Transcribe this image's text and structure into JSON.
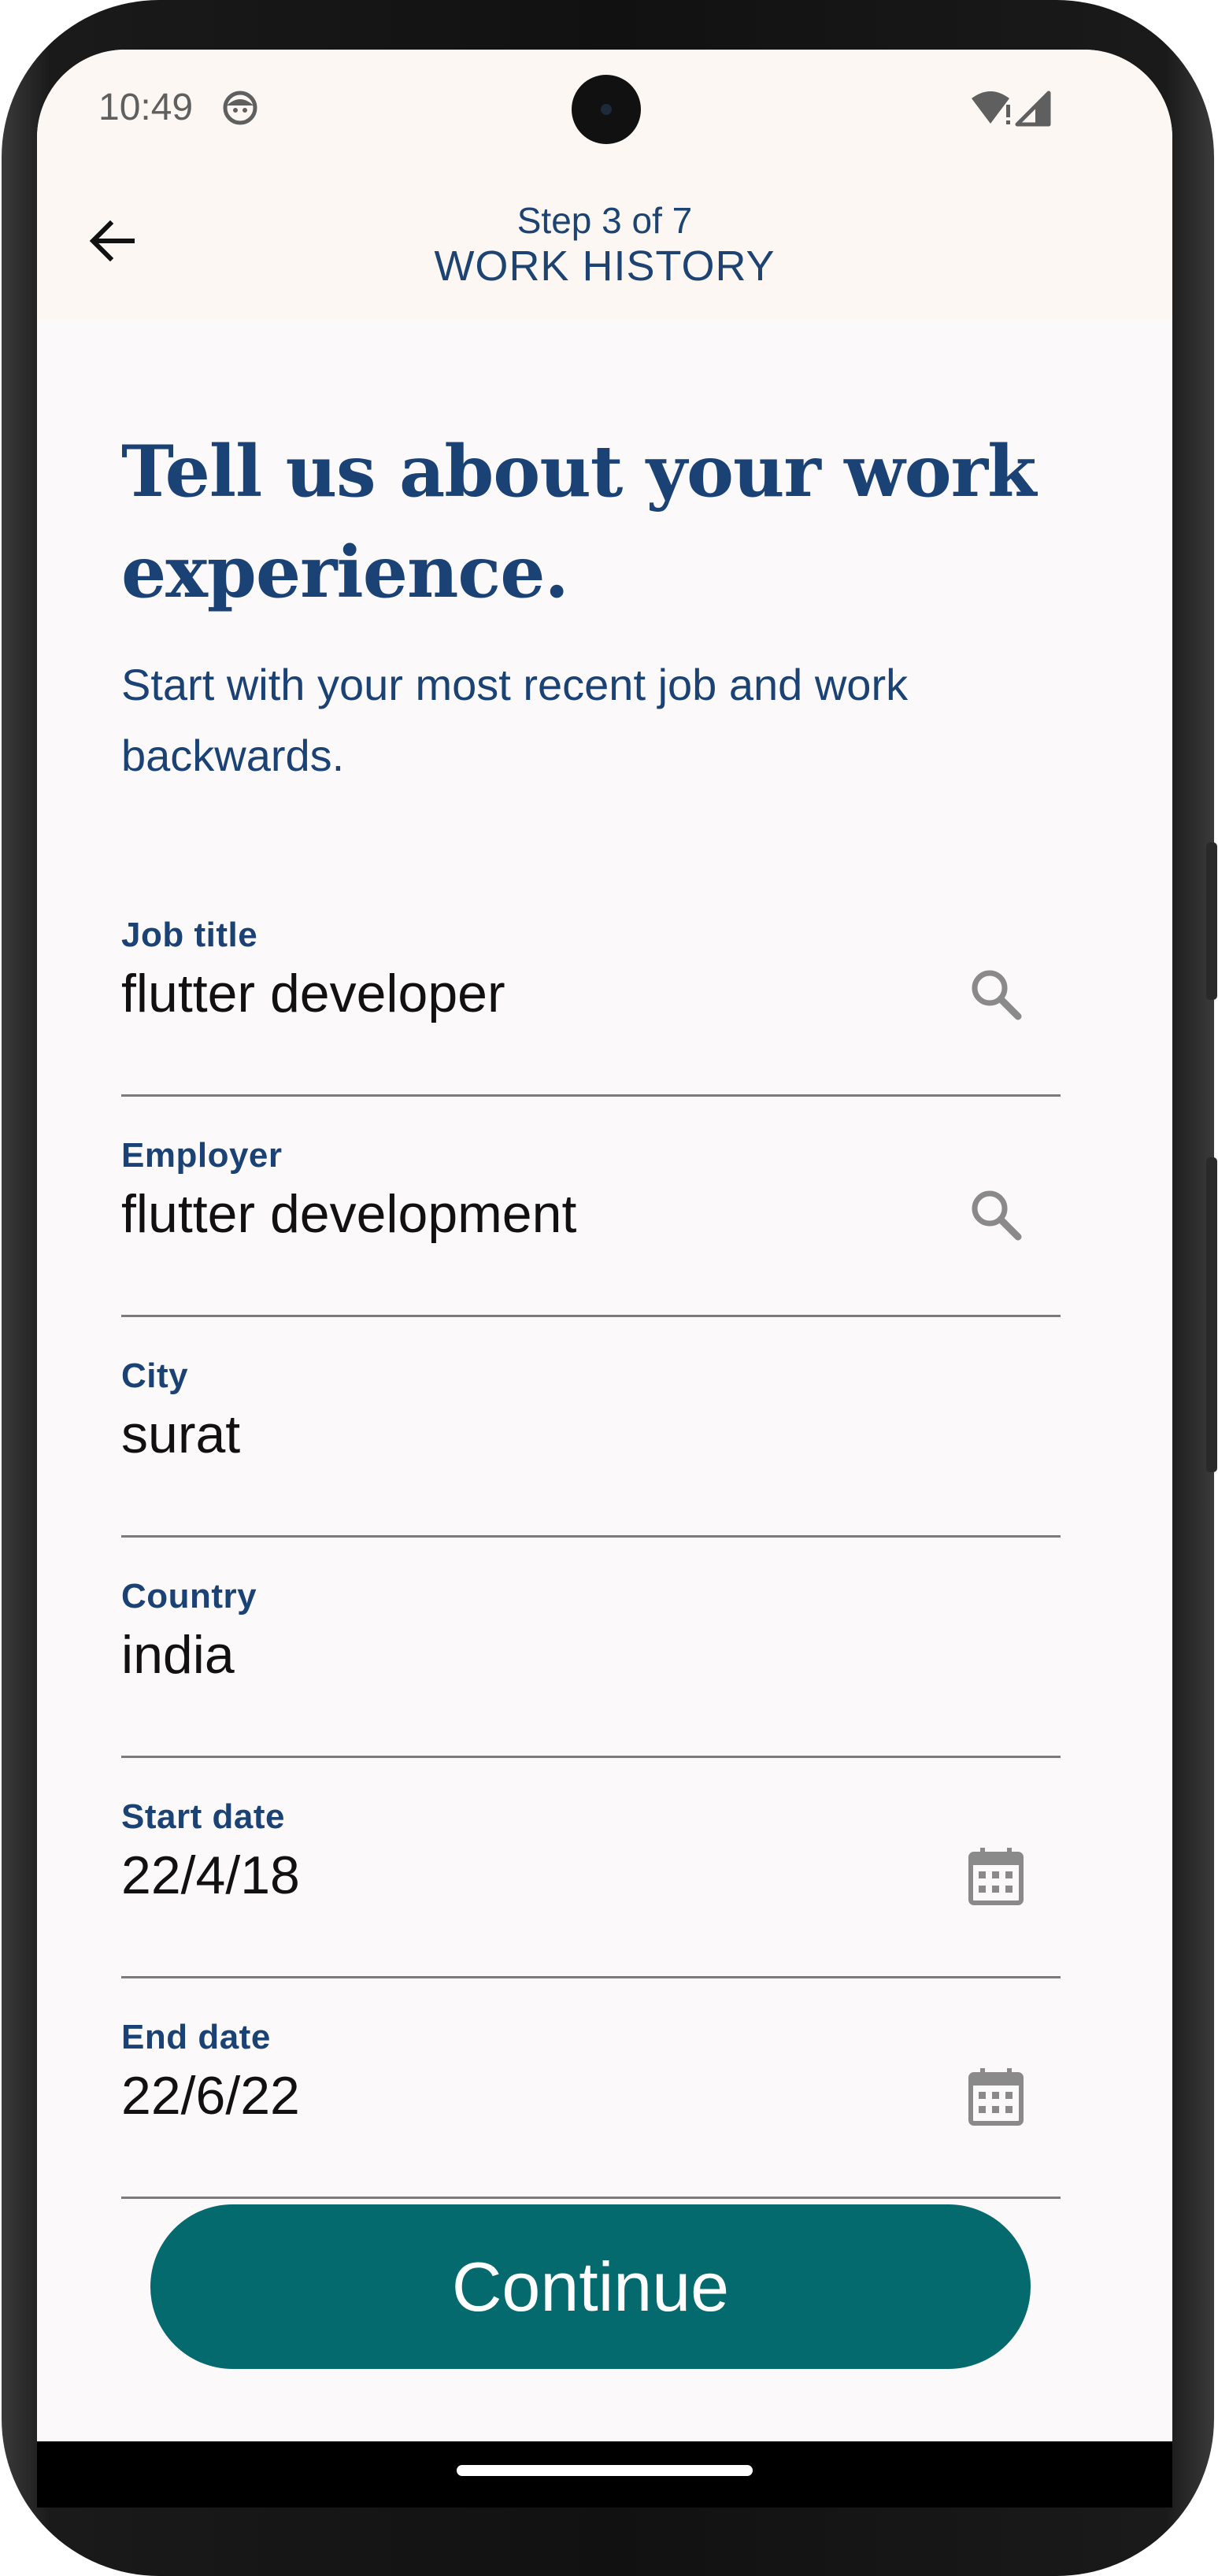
{
  "status_bar": {
    "time": "10:49",
    "app_icon": "notification-face-icon",
    "wifi_icon": "wifi-alert-icon",
    "signal_icon": "cellular-signal-icon"
  },
  "header": {
    "back_icon": "arrow-back-icon",
    "step": "Step 3 of 7",
    "title": "WORK HISTORY"
  },
  "heading": "Tell us about your work experience.",
  "subtitle": "Start with your most recent job and work backwards.",
  "fields": {
    "job_title": {
      "label": "Job title",
      "value": "flutter developer",
      "icon": "search-icon"
    },
    "employer": {
      "label": "Employer",
      "value": "flutter development",
      "icon": "search-icon"
    },
    "city": {
      "label": "City",
      "value": "surat"
    },
    "country": {
      "label": "Country",
      "value": "india"
    },
    "start_date": {
      "label": "Start date",
      "value": "22/4/18",
      "icon": "calendar-icon"
    },
    "end_date": {
      "label": "End date",
      "value": "22/6/22",
      "icon": "calendar-icon"
    }
  },
  "continue_label": "Continue",
  "colors": {
    "header_background": "#fcf7f2",
    "page_background": "#fcf9fb",
    "text_primary": "#1b4274",
    "button_background": "#046a6e",
    "button_text": "#ffffff"
  }
}
